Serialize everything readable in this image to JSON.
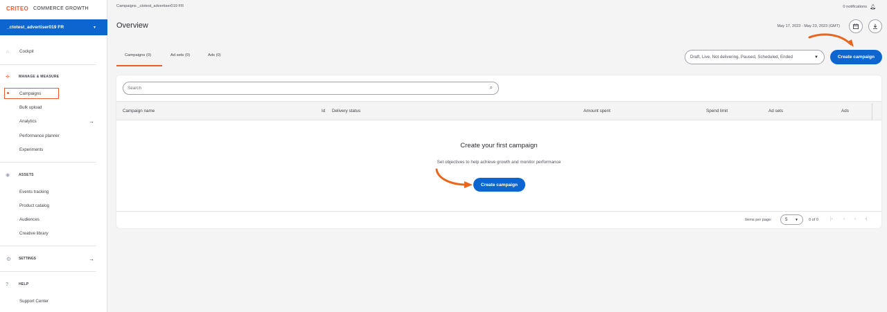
{
  "brand": {
    "logo": "CRITEO",
    "product": "COMMERCE GROWTH"
  },
  "account": {
    "name": "_ctotest_advertiser019 FR",
    "caret": "▾"
  },
  "sidebar": {
    "cockpit": "Cockpit",
    "manage_measure": "MANAGE & MEASURE",
    "manage_items": [
      "Campaigns",
      "Bulk upload",
      "Analytics",
      "Performance planner",
      "Experiments"
    ],
    "assets": "ASSETS",
    "asset_items": [
      "Events tracking",
      "Product catalog",
      "Audiences",
      "Creative library"
    ],
    "settings": "SETTINGS",
    "help": "HELP",
    "help_items": [
      "Support Center"
    ]
  },
  "header": {
    "breadcrumb": "Campaigns  _ctotest_advertiser019 FR",
    "notifications": "0 notifications",
    "title": "Overview",
    "date_range": "May 17, 2023 - May 23, 2023 (GMT)"
  },
  "tabs": [
    "Campaigns (0)",
    "Ad sets (0)",
    "Ads (0)"
  ],
  "filter": {
    "value": "Draft, Live, Not delivering, Paused, Scheduled, Ended"
  },
  "create_button": "Create campaign",
  "table": {
    "search_placeholder": "Search",
    "columns": [
      "Campaign name",
      "Id",
      "Delivery status",
      "Amount spent",
      "Spend limit",
      "Ad sets",
      "Ads"
    ]
  },
  "empty_state": {
    "title": "Create your first campaign",
    "subtitle": "Set objectives to help achieve growth and monitor performance",
    "button": "Create campaign"
  },
  "pagination": {
    "items_per_page_label": "Items per page:",
    "items_per_page": "5",
    "range": "0 of 0"
  },
  "colors": {
    "accent": "#0d66d0",
    "brand": "#f0572a",
    "annotation": "#e8661e"
  }
}
